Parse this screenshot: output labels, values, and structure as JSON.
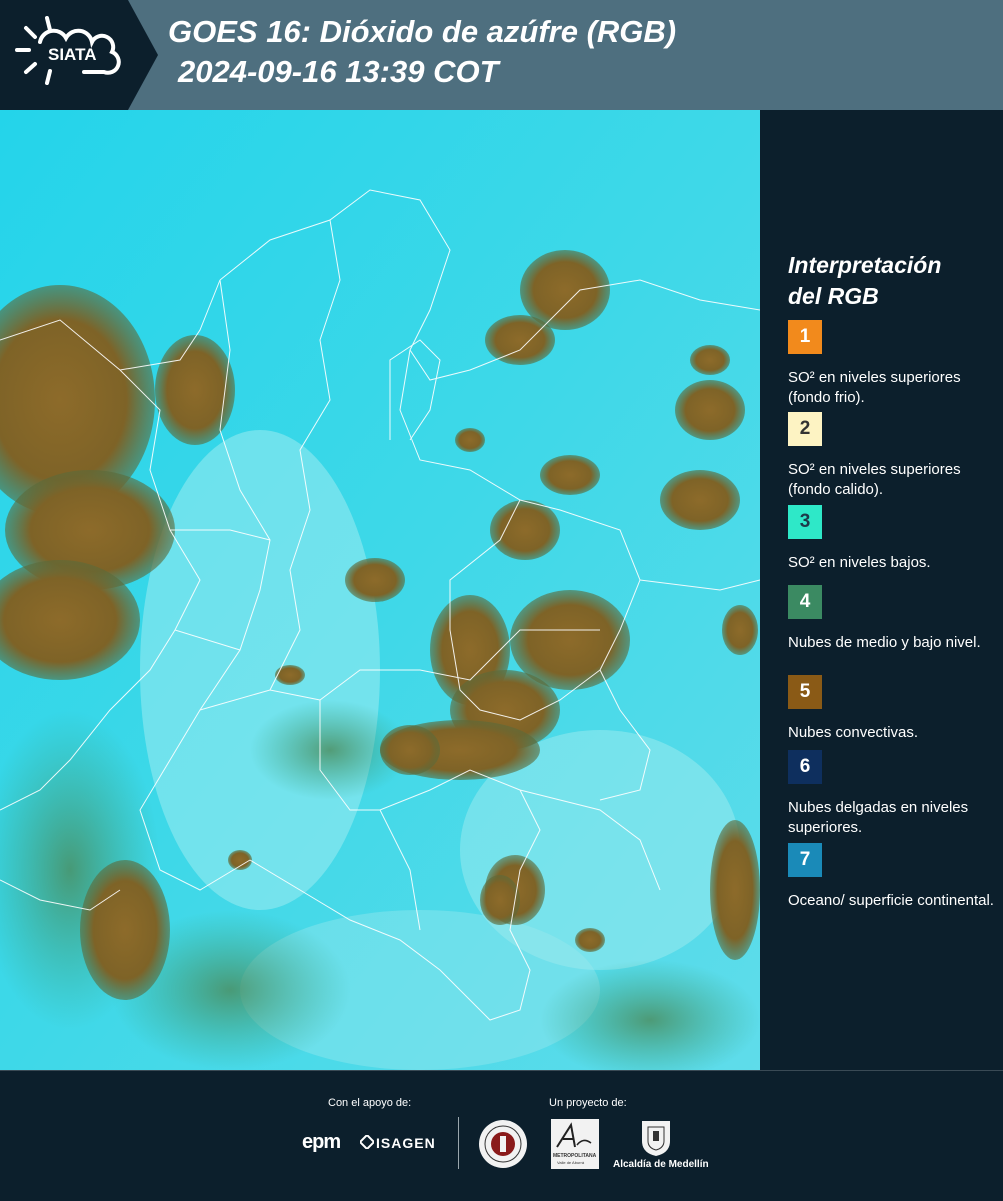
{
  "header": {
    "logo_text": "SIATA",
    "title_line1": "GOES 16: Dióxido de azúfre (RGB)",
    "title_line2": "2024-09-16 13:39 COT"
  },
  "map": {
    "background_colors": {
      "sky": "#27d6ea",
      "cloud": "#8a6a2a",
      "border": "#ffffff"
    },
    "icon": "satellite-composite-map"
  },
  "legend": {
    "title_line1": "Interpretación",
    "title_line2": "del RGB",
    "items": [
      {
        "number": "1",
        "color": "#f28a1c",
        "text_color": "#ffffff",
        "label": "SO² en niveles superiores (fondo frio)."
      },
      {
        "number": "2",
        "color": "#fdf3c3",
        "text_color": "#333333",
        "label": "SO² en niveles superiores (fondo calido)."
      },
      {
        "number": "3",
        "color": "#2ee8c8",
        "text_color": "#1d3a4a",
        "label": "SO² en niveles bajos."
      },
      {
        "number": "4",
        "color": "#3b8a62",
        "text_color": "#ffffff",
        "label": "Nubes de medio y bajo nivel."
      },
      {
        "number": "5",
        "color": "#8a5a16",
        "text_color": "#ffffff",
        "label": "Nubes convectivas."
      },
      {
        "number": "6",
        "color": "#0e2f5e",
        "text_color": "#ffffff",
        "label": "Nubes delgadas en niveles superiores."
      },
      {
        "number": "7",
        "color": "#1a8ab8",
        "text_color": "#ffffff",
        "label": "Oceano/ superficie continental."
      }
    ]
  },
  "footer": {
    "support_label": "Con el apoyo de:",
    "project_label": "Un proyecto de:",
    "epm_text": "epm",
    "isagen_text": "ISAGEN",
    "area_text": "METROPOLITANA",
    "area_sub": "Valle de Aburrá",
    "alcaldia_text": "Alcaldía de Medellín"
  }
}
